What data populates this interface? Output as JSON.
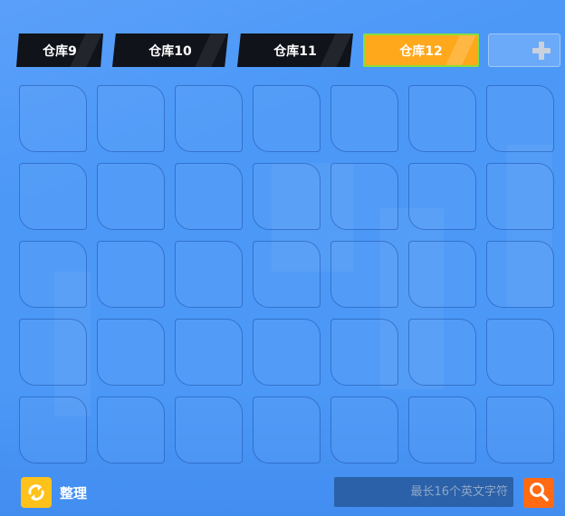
{
  "tabs": [
    {
      "label": "仓库9",
      "active": false
    },
    {
      "label": "仓库10",
      "active": false
    },
    {
      "label": "仓库11",
      "active": false
    },
    {
      "label": "仓库12",
      "active": true
    }
  ],
  "add_tab": {
    "icon": "plus-icon"
  },
  "grid": {
    "rows": 5,
    "columns": 7
  },
  "bottom_bar": {
    "sort_label": "整理",
    "sort_icon": "refresh-arrows-icon",
    "search_placeholder": "最长16个英文字符",
    "search_value": "",
    "search_icon": "magnifier-icon"
  },
  "colors": {
    "background": "#4b98f7",
    "tab_inactive": "#101319",
    "tab_active": "#ffa81b",
    "tab_active_border": "#85e03a",
    "sort_button": "#ffc21a",
    "search_button": "#ff6a12"
  }
}
